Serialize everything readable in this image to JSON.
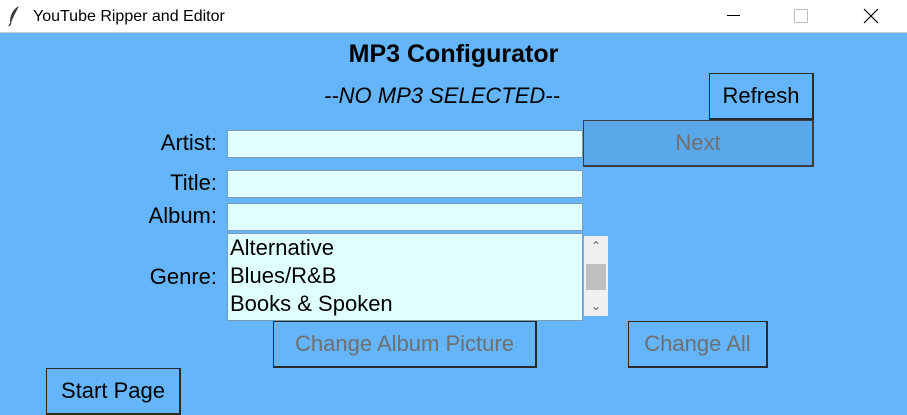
{
  "window": {
    "title": "YouTube Ripper and Editor",
    "icon": "feather-icon"
  },
  "page": {
    "heading": "MP3 Configurator",
    "status": "--NO MP3 SELECTED--"
  },
  "buttons": {
    "refresh": "Refresh",
    "next": "Next",
    "change_album_picture": "Change Album Picture",
    "change_all": "Change All",
    "start_page": "Start Page"
  },
  "form": {
    "artist_label": "Artist:",
    "artist_value": "",
    "title_label": "Title:",
    "title_value": "",
    "album_label": "Album:",
    "album_value": "",
    "genre_label": "Genre:",
    "genre_options": [
      "Alternative",
      "Blues/R&B",
      "Books & Spoken"
    ]
  },
  "colors": {
    "background": "#64b5fa",
    "field_background": "#e0ffff",
    "disabled_text": "#6f6f6f"
  }
}
